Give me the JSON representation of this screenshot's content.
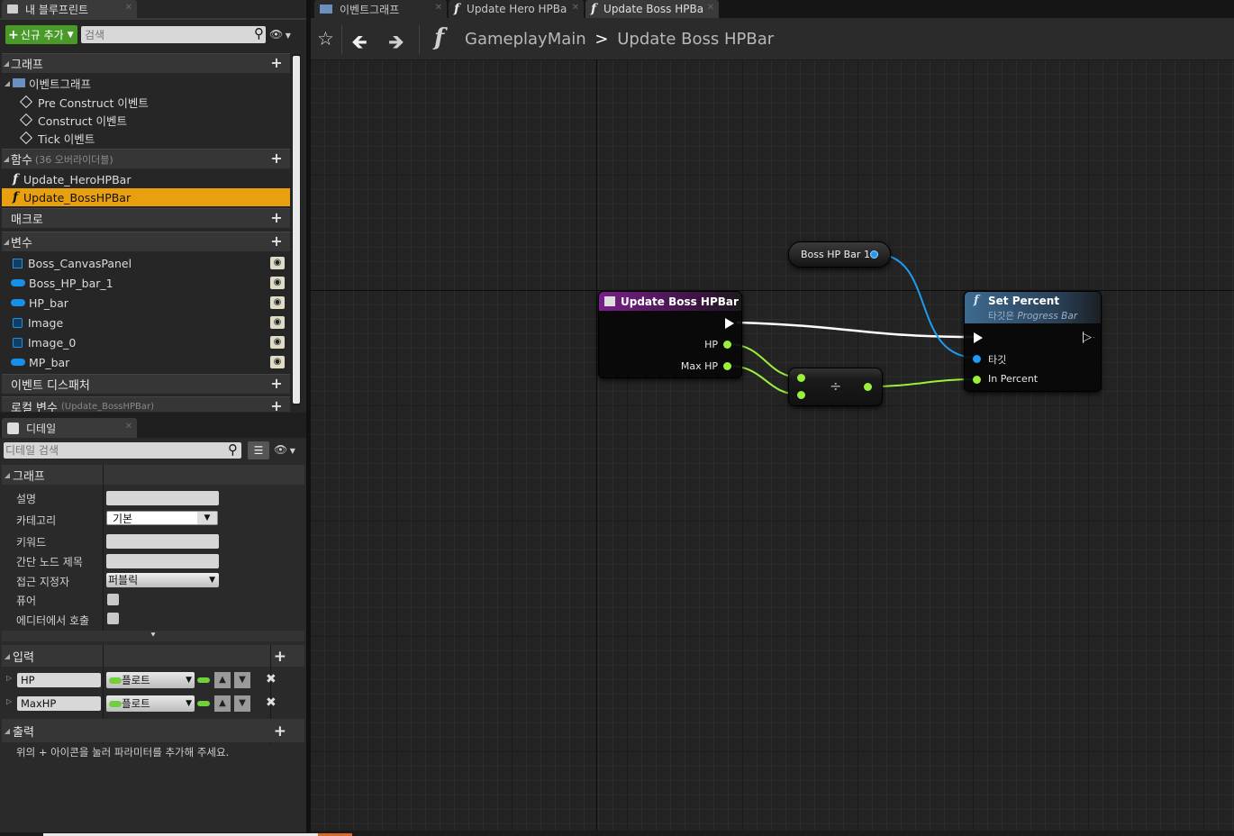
{
  "tabs_left": [
    {
      "label": "내 블루프린트",
      "icon": "blueprint-icon"
    }
  ],
  "tabs_right": [
    {
      "label": "이벤트그래프",
      "icon": "event-graph-icon"
    },
    {
      "label": "Update Hero HPBa",
      "icon": "function-icon"
    },
    {
      "label": "Update Boss HPBa",
      "icon": "function-icon"
    }
  ],
  "toolbar": {
    "add_new": "신규 추가",
    "search_placeholder": "검색"
  },
  "sections": {
    "graph": "그래프",
    "event_graph": "이벤트그래프",
    "functions": "함수",
    "functions_count": "(36 오버라이더블)",
    "macros": "매크로",
    "variables": "변수",
    "dispatchers": "이벤트 디스패처",
    "local_vars": "로컬 변수",
    "local_vars_scope": "(Update_BossHPBar)"
  },
  "events": [
    "Pre Construct 이벤트",
    "Construct 이벤트",
    "Tick 이벤트"
  ],
  "functions": [
    {
      "label": "Update_HeroHPBar",
      "selected": false
    },
    {
      "label": "Update_BossHPBar",
      "selected": true
    }
  ],
  "variables": [
    {
      "label": "Boss_CanvasPanel",
      "icon": "canvas-panel-icon"
    },
    {
      "label": "Boss_HP_bar_1",
      "icon": "object-pill-icon"
    },
    {
      "label": "HP_bar",
      "icon": "object-pill-icon"
    },
    {
      "label": "Image",
      "icon": "image-icon"
    },
    {
      "label": "Image_0",
      "icon": "image-icon"
    },
    {
      "label": "MP_bar",
      "icon": "object-pill-icon"
    }
  ],
  "details": {
    "tab": "디테일",
    "search_placeholder": "디테일 검색",
    "graph_section": "그래프",
    "props": {
      "description": "설명",
      "category": "카테고리",
      "category_value": "기본",
      "keywords": "키워드",
      "compact_title": "간단 노드 제목",
      "access": "접근 지정자",
      "access_value": "퍼블릭",
      "pure": "퓨어",
      "call_in_editor": "에디터에서 호출"
    },
    "inputs_section": "입력",
    "inputs": [
      {
        "name": "HP",
        "type": "플로트"
      },
      {
        "name": "MaxHP",
        "type": "플로트"
      }
    ],
    "outputs_section": "출력",
    "outputs_hint": "위의 + 아이콘을 눌러 파라미터를 추가해 주세요."
  },
  "breadcrumb": {
    "root": "GameplayMain",
    "sep": ">",
    "current": "Update Boss HPBar"
  },
  "nodes": {
    "entry": {
      "title": "Update Boss HPBar",
      "pins": [
        "HP",
        "Max HP"
      ]
    },
    "getter": {
      "label": "Boss HP Bar 1"
    },
    "divide": {
      "symbol": "÷"
    },
    "set_percent": {
      "title": "Set Percent",
      "subtitle_prefix": "타깃은",
      "subtitle_class": "Progress Bar",
      "pins": [
        "타깃",
        "In Percent"
      ]
    }
  },
  "colors": {
    "selected": "#e8a00f",
    "exec": "#ffffff",
    "float": "#9af03a",
    "object": "#1f9cf0",
    "entry_header": "#7a1f8a",
    "call_header": "#3a5a7a"
  }
}
